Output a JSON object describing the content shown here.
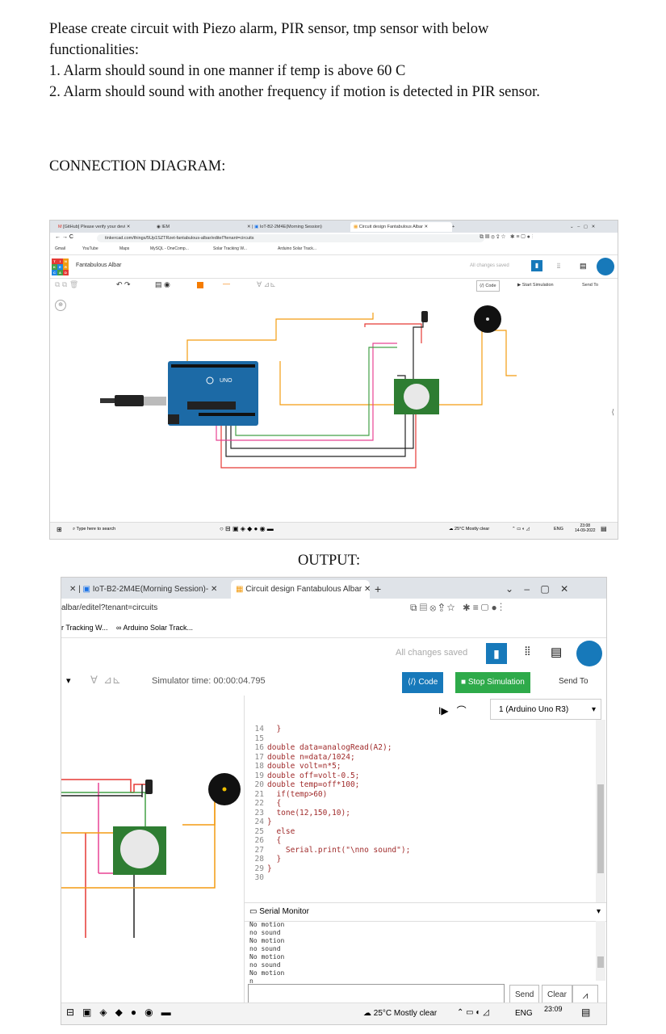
{
  "document": {
    "intro_line1": "Please create circuit with Piezo alarm, PIR sensor, tmp sensor with below",
    "intro_line2": "functionalities:",
    "item1": "1. Alarm should sound in one manner if temp is above 60 C",
    "item2": "2. Alarm should sound with another frequency if motion is detected in PIR sensor.",
    "section_connection": "CONNECTION DIAGRAM:",
    "section_output": "OUTPUT:"
  },
  "screenshot1": {
    "tab1": "[GitHub] Please verify your devi",
    "tab2": "IEM",
    "tab3": "IoT-B2-2M4E(Morning Session)",
    "tab4": "Circuit design Fantabulous Albar",
    "url": "tinkercad.com/things/5Up1SZTRzet-fantabulous-albar/editel?tenant=circuits",
    "bookmarks": [
      "Gmail",
      "YouTube",
      "Maps",
      "MySQL - OneComp...",
      "Solar Tracking W...",
      "Arduino Solar Track..."
    ],
    "project_name": "Fantabulous Albar",
    "saved_status": "All changes saved",
    "code_label": "Code",
    "start_sim_label": "Start Simulation",
    "send_to_label": "Send To",
    "search_placeholder": "Type here to search",
    "weather": "25°C  Mostly clear",
    "lang": "ENG",
    "time": "23:08",
    "date": "14-09-2022",
    "board_label": "UNO"
  },
  "screenshot2": {
    "tab1": "IoT-B2-2M4E(Morning Session)-",
    "tab2": "Circuit design Fantabulous Albar",
    "url": "albar/editel?tenant=circuits",
    "bookmark1": "r Tracking W...",
    "bookmark2": "Arduino Solar Track...",
    "saved_status": "All changes saved",
    "sim_time": "Simulator time: 00:00:04.795",
    "code_label": "Code",
    "stop_sim_label": "Stop Simulation",
    "send_to_label": "Send To",
    "board_select": "1 (Arduino Uno R3)",
    "code_lines": [
      {
        "n": "14",
        "t": "  }"
      },
      {
        "n": "15",
        "t": ""
      },
      {
        "n": "16",
        "t": "double data=analogRead(A2);"
      },
      {
        "n": "17",
        "t": "double n=data/1024;"
      },
      {
        "n": "18",
        "t": "double volt=n*5;"
      },
      {
        "n": "19",
        "t": "double off=volt-0.5;"
      },
      {
        "n": "20",
        "t": "double temp=off*100;"
      },
      {
        "n": "21",
        "t": "  if(temp>60)"
      },
      {
        "n": "22",
        "t": "  {"
      },
      {
        "n": "23",
        "t": "  tone(12,150,10);"
      },
      {
        "n": "24",
        "t": "}"
      },
      {
        "n": "25",
        "t": "  else"
      },
      {
        "n": "26",
        "t": "  {"
      },
      {
        "n": "27",
        "t": "    Serial.print(\"\\nno sound\");"
      },
      {
        "n": "28",
        "t": "  }"
      },
      {
        "n": "29",
        "t": "}"
      },
      {
        "n": "30",
        "t": ""
      }
    ],
    "serial_monitor_label": "Serial Monitor",
    "serial_output": [
      "No motion",
      "no sound",
      "No motion",
      "no sound",
      "No motion",
      "no sound",
      "No motion",
      "n"
    ],
    "send_label": "Send",
    "clear_label": "Clear",
    "weather": "25°C  Mostly clear",
    "lang": "ENG",
    "time": "23:09"
  },
  "colors": {
    "tinkercad_blue": "#1779ba",
    "wire_red": "#e53935",
    "wire_orange": "#f39c12",
    "wire_green": "#43a047",
    "wire_pink": "#e84393",
    "wire_black": "#222222",
    "arduino_blue": "#1c6aa6",
    "pir_green": "#2e7d32"
  }
}
